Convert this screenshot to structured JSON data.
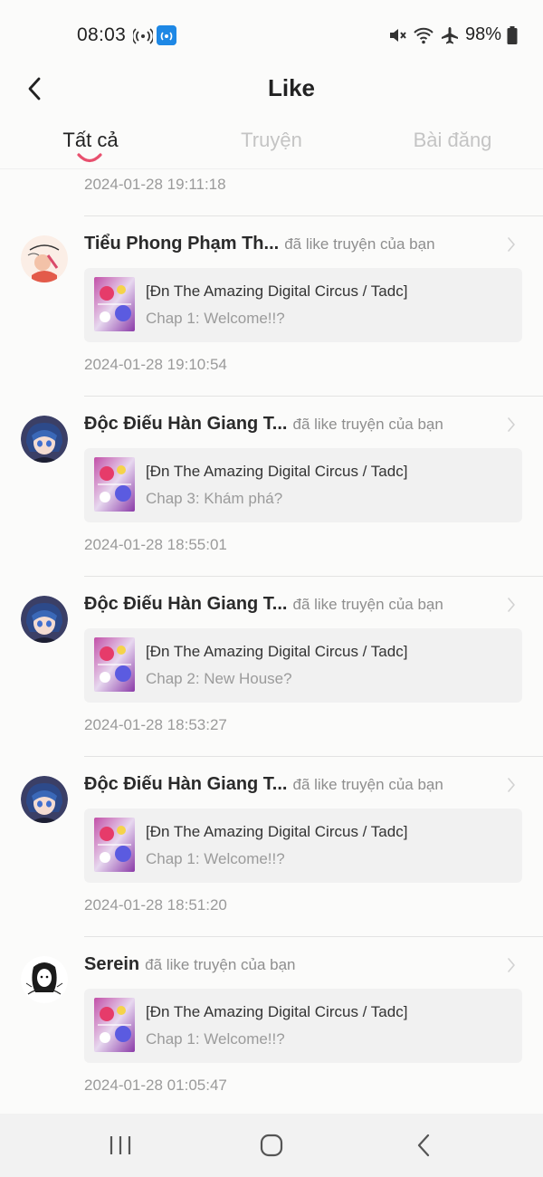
{
  "status_bar": {
    "time": "08:03",
    "battery": "98%"
  },
  "header": {
    "title": "Like"
  },
  "tabs": [
    {
      "label": "Tất cả",
      "active": true
    },
    {
      "label": "Truyện",
      "active": false
    },
    {
      "label": "Bài đăng",
      "active": false
    }
  ],
  "colors": {
    "accent": "#e8506e",
    "background": "#fbfbfa",
    "card": "#f1f1f1",
    "status_icon_blue": "#1e88e5"
  },
  "feed": {
    "first_timestamp": "2024-01-28 19:11:18",
    "items": [
      {
        "user": "Tiểu Phong Phạm Th...",
        "action": "đã like truyện của bạn",
        "story": "[Đn The Amazing Digital Circus / Tadc]",
        "chapter": "Chap 1: Welcome!!?",
        "time": "2024-01-28 19:10:54",
        "avatar": "sketch-avatar"
      },
      {
        "user": "Độc Điếu Hàn Giang T...",
        "action": "đã like truyện của bạn",
        "story": "[Đn The Amazing Digital Circus / Tadc]",
        "chapter": "Chap 3: Khám phá?",
        "time": "2024-01-28 18:55:01",
        "avatar": "anime-avatar"
      },
      {
        "user": "Độc Điếu Hàn Giang T...",
        "action": "đã like truyện của bạn",
        "story": "[Đn The Amazing Digital Circus / Tadc]",
        "chapter": "Chap 2: New House?",
        "time": "2024-01-28 18:53:27",
        "avatar": "anime-avatar"
      },
      {
        "user": "Độc Điếu Hàn Giang T...",
        "action": "đã like truyện của bạn",
        "story": "[Đn The Amazing Digital Circus / Tadc]",
        "chapter": "Chap 1: Welcome!!?",
        "time": "2024-01-28 18:51:20",
        "avatar": "anime-avatar"
      },
      {
        "user": "Serein",
        "action": "đã like truyện của bạn",
        "story": "[Đn The Amazing Digital Circus / Tadc]",
        "chapter": "Chap 1: Welcome!!?",
        "time": "2024-01-28 01:05:47",
        "avatar": "lineart-avatar"
      }
    ]
  },
  "nav_bar": {
    "icons": [
      "recent-apps-icon",
      "home-icon",
      "back-icon"
    ]
  }
}
